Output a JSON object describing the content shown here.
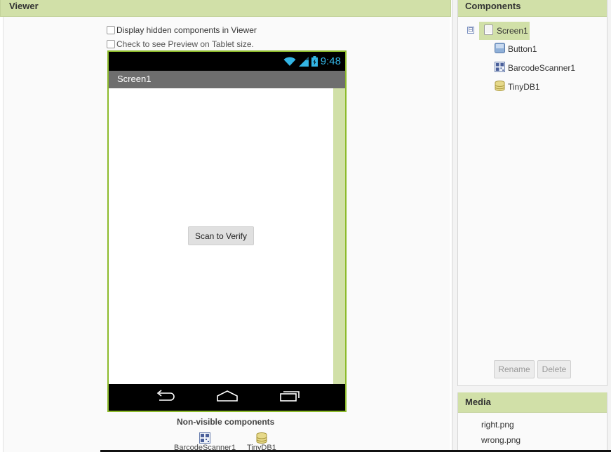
{
  "viewer": {
    "title": "Viewer",
    "show_hidden_label": "Display hidden components in Viewer",
    "tablet_label": "Check to see Preview on Tablet size."
  },
  "phone": {
    "time": "9:48",
    "screen_title": "Screen1",
    "scan_button_label": "Scan to Verify"
  },
  "nonvisible": {
    "title": "Non-visible components",
    "items": [
      {
        "label": "BarcodeScanner1",
        "icon": "barcode-scanner-icon"
      },
      {
        "label": "TinyDB1",
        "icon": "database-icon"
      }
    ]
  },
  "components": {
    "title": "Components",
    "tree_toggle": "⊟",
    "root": {
      "label": "Screen1",
      "icon": "screen-icon"
    },
    "children": [
      {
        "label": "Button1",
        "icon": "button-icon"
      },
      {
        "label": "BarcodeScanner1",
        "icon": "barcode-scanner-icon"
      },
      {
        "label": "TinyDB1",
        "icon": "database-icon"
      }
    ],
    "rename_label": "Rename",
    "delete_label": "Delete"
  },
  "media": {
    "title": "Media",
    "items": [
      "right.png",
      "wrong.png"
    ]
  },
  "colors": {
    "header_green": "#d1e0a8",
    "phone_border": "#8cba2b",
    "status_blue": "#33b5e5"
  }
}
